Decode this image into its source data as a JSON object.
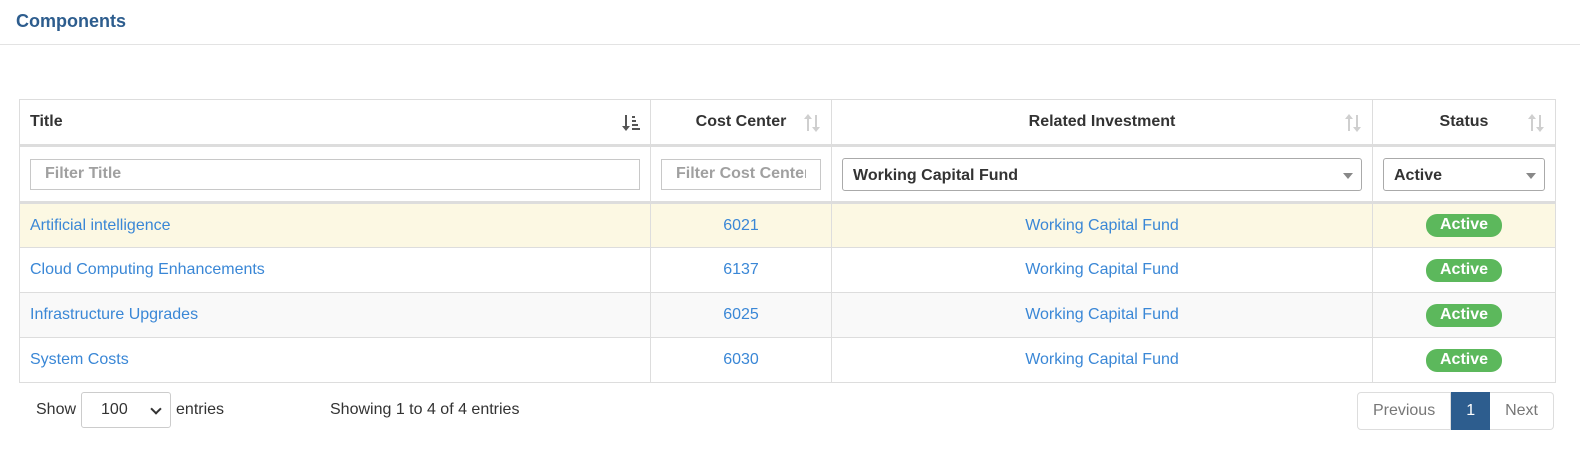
{
  "panel": {
    "title": "Components"
  },
  "table": {
    "columns": [
      "Title",
      "Cost Center",
      "Related Investment",
      "Status"
    ],
    "filters": {
      "title_placeholder": "Filter Title",
      "cost_center_placeholder": "Filter Cost Center",
      "related_investment_selected": "Working Capital Fund",
      "status_selected": "Active"
    },
    "rows": [
      {
        "title": "Artificial intelligence",
        "cost_center": "6021",
        "related_investment": "Working Capital Fund",
        "status": "Active"
      },
      {
        "title": "Cloud Computing Enhancements",
        "cost_center": "6137",
        "related_investment": "Working Capital Fund",
        "status": "Active"
      },
      {
        "title": "Infrastructure Upgrades",
        "cost_center": "6025",
        "related_investment": "Working Capital Fund",
        "status": "Active"
      },
      {
        "title": "System Costs",
        "cost_center": "6030",
        "related_investment": "Working Capital Fund",
        "status": "Active"
      }
    ]
  },
  "footer": {
    "show_label": "Show",
    "page_length": "100",
    "entries_label": "entries",
    "info": "Showing 1 to 4 of 4 entries",
    "previous": "Previous",
    "current_page": "1",
    "next": "Next"
  },
  "colors": {
    "title": "#2d5d8e",
    "link": "#3a87d6",
    "active_badge": "#5cb85c",
    "highlight_row": "#fcf8e3",
    "current_page": "#2d5d8e"
  }
}
